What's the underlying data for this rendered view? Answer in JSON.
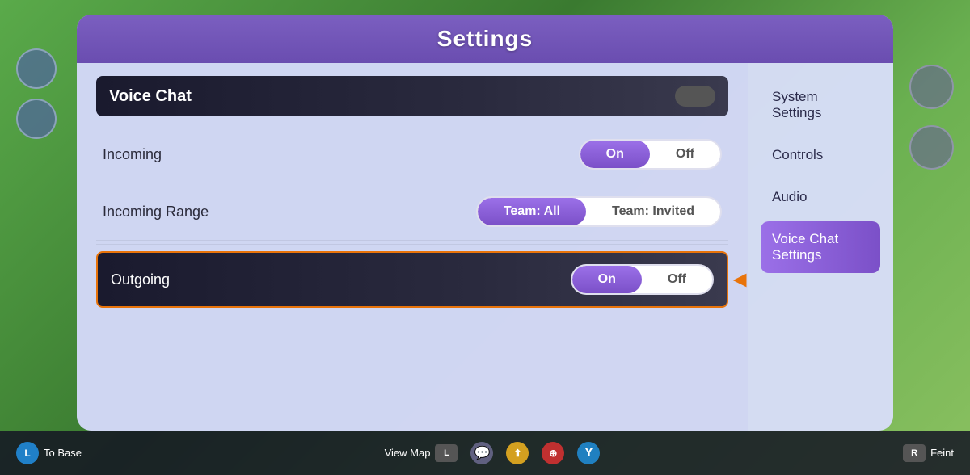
{
  "app": {
    "title": "Settings"
  },
  "sidebar": {
    "items": [
      {
        "id": "system-settings",
        "label": "System Settings",
        "active": false
      },
      {
        "id": "controls",
        "label": "Controls",
        "active": false
      },
      {
        "id": "audio",
        "label": "Audio",
        "active": false
      },
      {
        "id": "voice-chat-settings",
        "label": "Voice Chat Settings",
        "active": true
      }
    ]
  },
  "main": {
    "section_header": "Voice Chat",
    "rows": [
      {
        "id": "incoming",
        "label": "Incoming",
        "toggle": {
          "on_label": "On",
          "off_label": "Off",
          "active": "on"
        }
      },
      {
        "id": "incoming-range",
        "label": "Incoming Range",
        "toggle": {
          "on_label": "Team: All",
          "off_label": "Team: Invited",
          "active": "on"
        }
      },
      {
        "id": "outgoing",
        "label": "Outgoing",
        "toggle": {
          "on_label": "On",
          "off_label": "Off",
          "active": "on"
        },
        "highlighted": true
      }
    ]
  },
  "bottom_bar": {
    "left": [
      {
        "label": "To Base",
        "button": "L"
      }
    ],
    "center": [
      {
        "label": "View Map",
        "button": "L"
      }
    ],
    "right": [
      {
        "label": "Feint",
        "button": "R"
      }
    ]
  }
}
